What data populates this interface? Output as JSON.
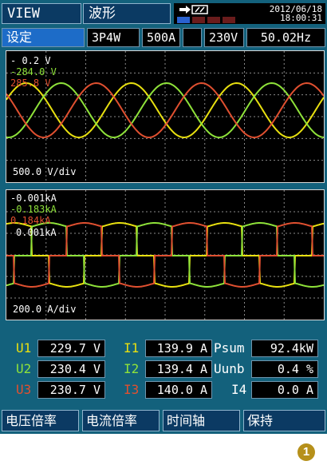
{
  "header": {
    "view_label": "VIEW",
    "mode_label": "波形",
    "status_icon": "battery-plug-icon",
    "level_bars_on": 1,
    "level_bars_total": 4,
    "date": "2012/06/18",
    "time": "18:00:31"
  },
  "settings_bar": {
    "setup_label": "设定",
    "wiring": "3P4W",
    "current_range": "500A",
    "blank": "",
    "voltage_range": "230V",
    "frequency": "50.02Hz"
  },
  "voltage_panel": {
    "channels": [
      {
        "label": "- 0.2 V",
        "color": "#ffffff"
      },
      {
        "label": "-284.0 V",
        "color": "#8fe23a"
      },
      {
        "label": "285.8 V",
        "color": "#e05030"
      }
    ],
    "scale": "500.0 V/div"
  },
  "current_panel": {
    "channels": [
      {
        "label": "-0.001kA",
        "color": "#ffffff"
      },
      {
        "label": "-0.183kA",
        "color": "#8fe23a"
      },
      {
        "label": "0.184kA",
        "color": "#e05030"
      },
      {
        "label": "0.001kA",
        "color": "#ffffff"
      }
    ],
    "scale": "200.0 A/div"
  },
  "measurements": {
    "rows": [
      {
        "u_label": "U1",
        "u_value": "229.7 V",
        "i_label": "I1",
        "i_value": "139.9 A",
        "p_label": "Psum",
        "p_value": "92.4kW",
        "color": "#e8e010"
      },
      {
        "u_label": "U2",
        "u_value": "230.4 V",
        "i_label": "I2",
        "i_value": "139.4 A",
        "p_label": "Uunb",
        "p_value": "0.4 %",
        "color": "#8fe23a"
      },
      {
        "u_label": "U3",
        "u_value": "230.7 V",
        "i_label": "I3",
        "i_value": "140.0 A",
        "p_label": "I4",
        "p_value": "0.0 A",
        "color": "#e05030"
      }
    ],
    "white": "#ffffff"
  },
  "softkeys": [
    "电压倍率",
    "电流倍率",
    "时间轴",
    "保持"
  ],
  "badge": "1",
  "colors": {
    "yellow": "#e8e010",
    "green": "#8fe23a",
    "red": "#e05030",
    "grid": "#8a8a8a"
  }
}
